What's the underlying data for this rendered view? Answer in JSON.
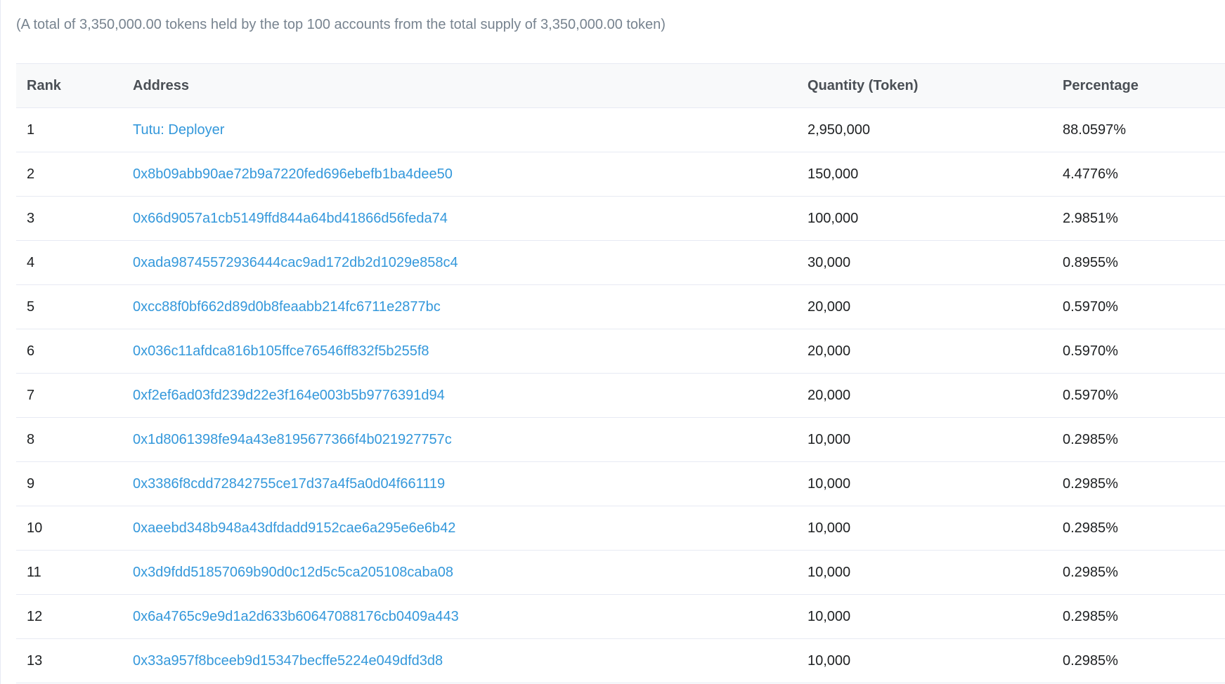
{
  "summary": "(A total of 3,350,000.00 tokens held by the top 100 accounts from the total supply of 3,350,000.00 token)",
  "table": {
    "headers": {
      "rank": "Rank",
      "address": "Address",
      "quantity": "Quantity (Token)",
      "percentage": "Percentage"
    },
    "rows": [
      {
        "rank": "1",
        "address": "Tutu: Deployer",
        "quantity": "2,950,000",
        "percentage": "88.0597%"
      },
      {
        "rank": "2",
        "address": "0x8b09abb90ae72b9a7220fed696ebefb1ba4dee50",
        "quantity": "150,000",
        "percentage": "4.4776%"
      },
      {
        "rank": "3",
        "address": "0x66d9057a1cb5149ffd844a64bd41866d56feda74",
        "quantity": "100,000",
        "percentage": "2.9851%"
      },
      {
        "rank": "4",
        "address": "0xada98745572936444cac9ad172db2d1029e858c4",
        "quantity": "30,000",
        "percentage": "0.8955%"
      },
      {
        "rank": "5",
        "address": "0xcc88f0bf662d89d0b8feaabb214fc6711e2877bc",
        "quantity": "20,000",
        "percentage": "0.5970%"
      },
      {
        "rank": "6",
        "address": "0x036c11afdca816b105ffce76546ff832f5b255f8",
        "quantity": "20,000",
        "percentage": "0.5970%"
      },
      {
        "rank": "7",
        "address": "0xf2ef6ad03fd239d22e3f164e003b5b9776391d94",
        "quantity": "20,000",
        "percentage": "0.5970%"
      },
      {
        "rank": "8",
        "address": "0x1d8061398fe94a43e8195677366f4b021927757c",
        "quantity": "10,000",
        "percentage": "0.2985%"
      },
      {
        "rank": "9",
        "address": "0x3386f8cdd72842755ce17d37a4f5a0d04f661119",
        "quantity": "10,000",
        "percentage": "0.2985%"
      },
      {
        "rank": "10",
        "address": "0xaeebd348b948a43dfdadd9152cae6a295e6e6b42",
        "quantity": "10,000",
        "percentage": "0.2985%"
      },
      {
        "rank": "11",
        "address": "0x3d9fdd51857069b90d0c12d5c5ca205108caba08",
        "quantity": "10,000",
        "percentage": "0.2985%"
      },
      {
        "rank": "12",
        "address": "0x6a4765c9e9d1a2d633b60647088176cb0409a443",
        "quantity": "10,000",
        "percentage": "0.2985%"
      },
      {
        "rank": "13",
        "address": "0x33a957f8bceeb9d15347becffe5224e049dfd3d8",
        "quantity": "10,000",
        "percentage": "0.2985%"
      }
    ]
  },
  "colors": {
    "link": "#3498db",
    "muted_text": "#77838f",
    "header_bg": "#f8f9fa",
    "border": "#e7eaf3"
  }
}
